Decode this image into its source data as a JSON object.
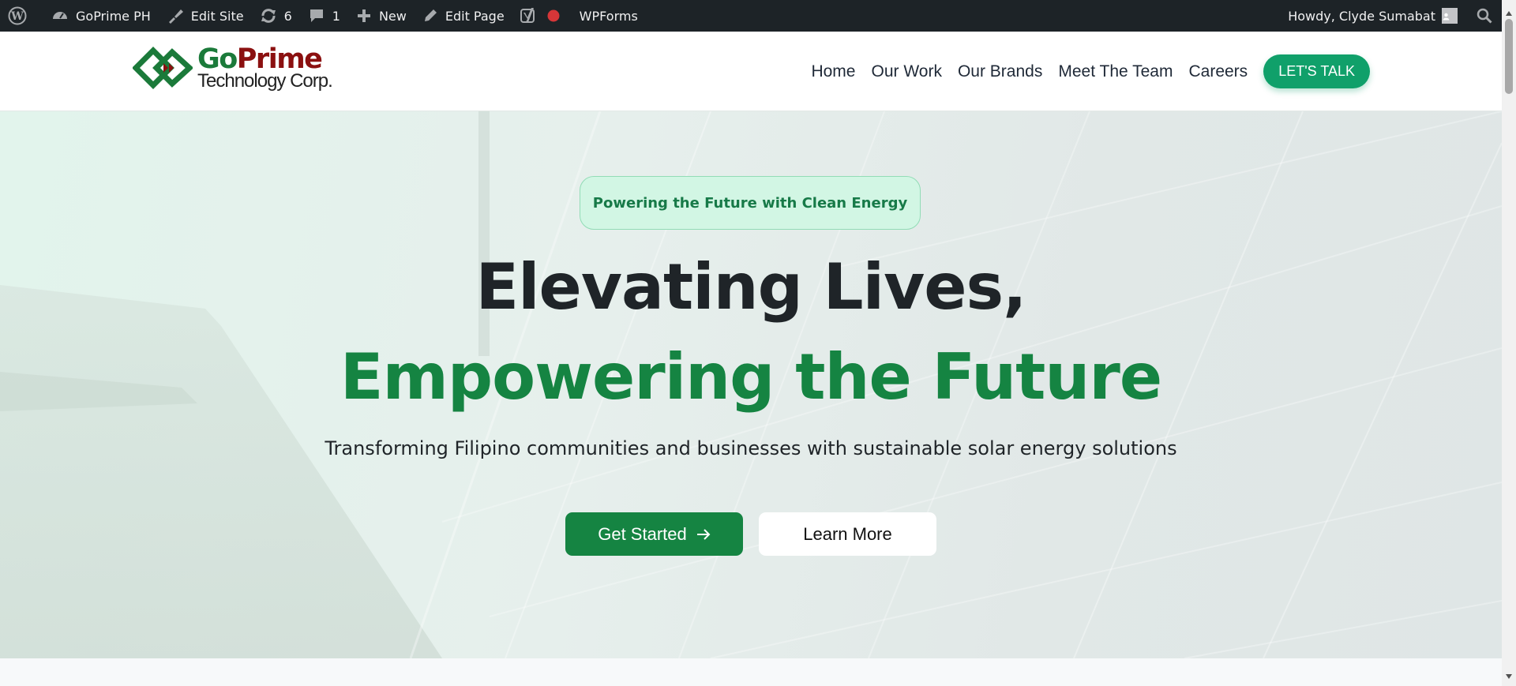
{
  "admin_bar": {
    "site_name": "GoPrime PH",
    "edit_site": "Edit Site",
    "updates_count": "6",
    "comments_count": "1",
    "new_label": "New",
    "edit_page": "Edit Page",
    "wpforms": "WPForms",
    "howdy": "Howdy, Clyde Sumabat"
  },
  "header": {
    "logo_go": "Go",
    "logo_prime": "Prime",
    "logo_subtitle": "Technology Corp.",
    "nav": [
      "Home",
      "Our Work",
      "Our Brands",
      "Meet The Team",
      "Careers"
    ],
    "cta": "LET'S TALK"
  },
  "hero": {
    "badge": "Powering the Future with Clean Energy",
    "headline_1": "Elevating Lives,",
    "headline_2": "Empowering the Future",
    "subtitle": "Transforming Filipino communities and businesses with sustainable solar energy solutions",
    "primary_button": "Get Started",
    "secondary_button": "Learn More"
  },
  "colors": {
    "admin_bar": "#1d2327",
    "brand_green": "#158442",
    "cta_green": "#10a06a",
    "brand_red": "#8b1010",
    "badge_bg": "#d2f6e4"
  },
  "icons": {
    "wordpress": "wordpress-icon",
    "dashboard": "dashboard-icon",
    "edit_site": "brush-icon",
    "updates": "refresh-icon",
    "comments": "comment-icon",
    "new": "plus-icon",
    "edit_page": "pencil-icon",
    "seo": "yoast-icon",
    "status": "red-dot-icon",
    "search": "search-icon",
    "arrow": "arrow-right-icon"
  }
}
